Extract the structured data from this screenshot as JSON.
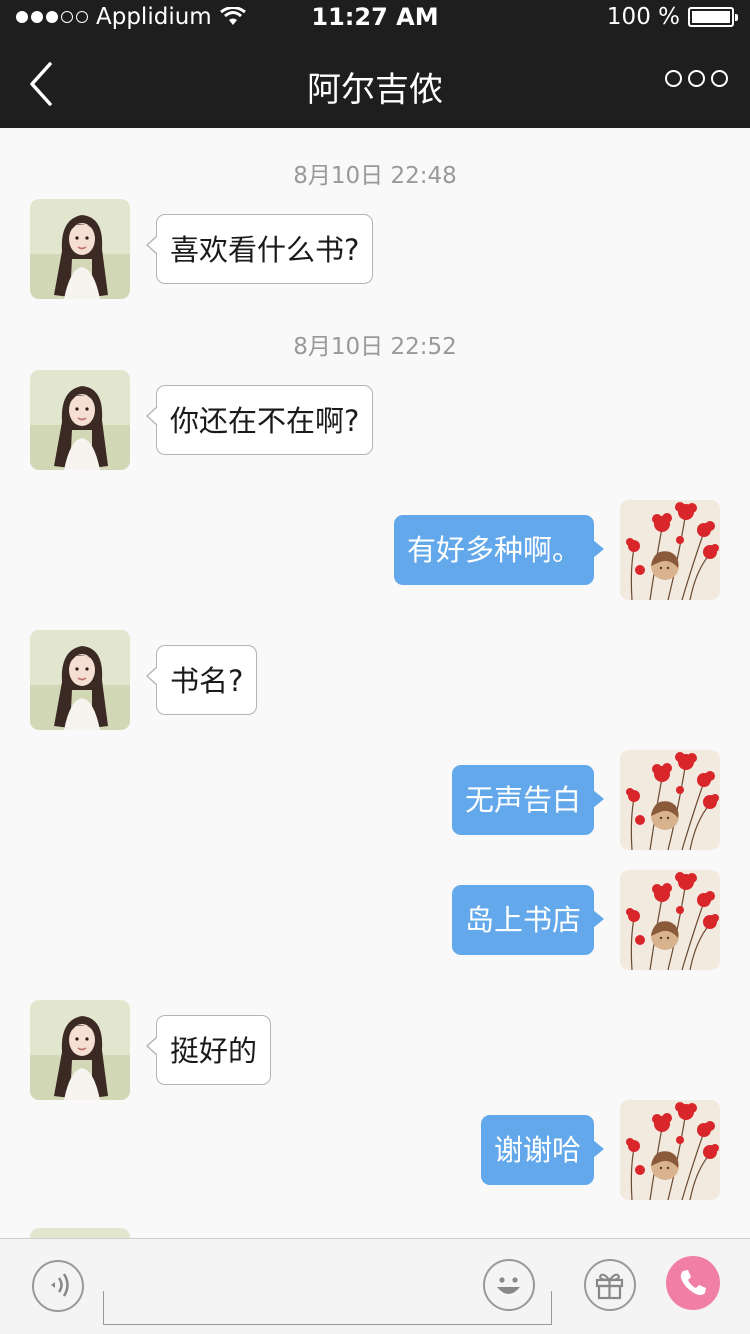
{
  "status_bar": {
    "carrier": "Applidium",
    "time": "11:27 AM",
    "battery": "100 %",
    "signal_icon": "signal-dots-icon",
    "wifi_icon": "wifi-icon",
    "battery_icon": "battery-icon"
  },
  "nav": {
    "title": "阿尔吉侬",
    "back_icon": "chevron-left-icon",
    "more_icon": "more-dots-icon"
  },
  "messages": {
    "ts1": "8月10日 22:48",
    "m1": "喜欢看什么书?",
    "ts2": "8月10日 22:52",
    "m2": "你还在不在啊?",
    "m3": "有好多种啊。",
    "m4": "书名?",
    "m5": "无声告白",
    "m6": "岛上书店",
    "m7": "挺好的",
    "m8": "谢谢哈"
  },
  "bottom_bar": {
    "voice_icon": "voice-icon",
    "emoji_icon": "smiley-icon",
    "gift_icon": "gift-icon",
    "call_icon": "phone-icon"
  },
  "colors": {
    "nav_background": "#1e1e1e",
    "outgoing_bubble": "#62a8ea",
    "incoming_bubble": "#ffffff",
    "call_button": "#f17fa5"
  }
}
